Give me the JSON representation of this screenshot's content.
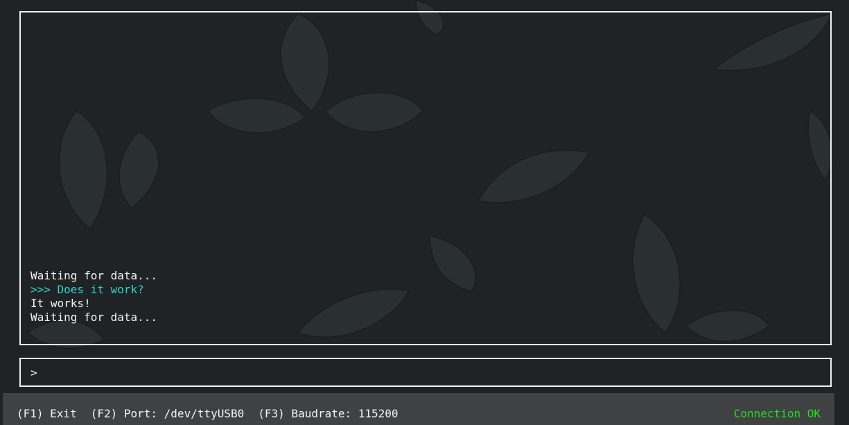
{
  "output": {
    "lines": [
      {
        "text": "Waiting for data...",
        "kind": "default"
      },
      {
        "text": ">>> Does it work?",
        "kind": "sent"
      },
      {
        "text": "It works!",
        "kind": "default"
      },
      {
        "text": "Waiting for data...",
        "kind": "default"
      }
    ]
  },
  "input": {
    "prompt": ">",
    "value": ""
  },
  "status": {
    "exit": "(F1) Exit",
    "port": "(F2) Port: /dev/ttyUSB0",
    "baudrate": "(F3) Baudrate: 115200",
    "connection": "Connection OK"
  },
  "colors": {
    "background": "#1f2326",
    "sent_text": "#2fd6c8",
    "connection_ok": "#1fe01f",
    "status_bar": "#404142"
  }
}
